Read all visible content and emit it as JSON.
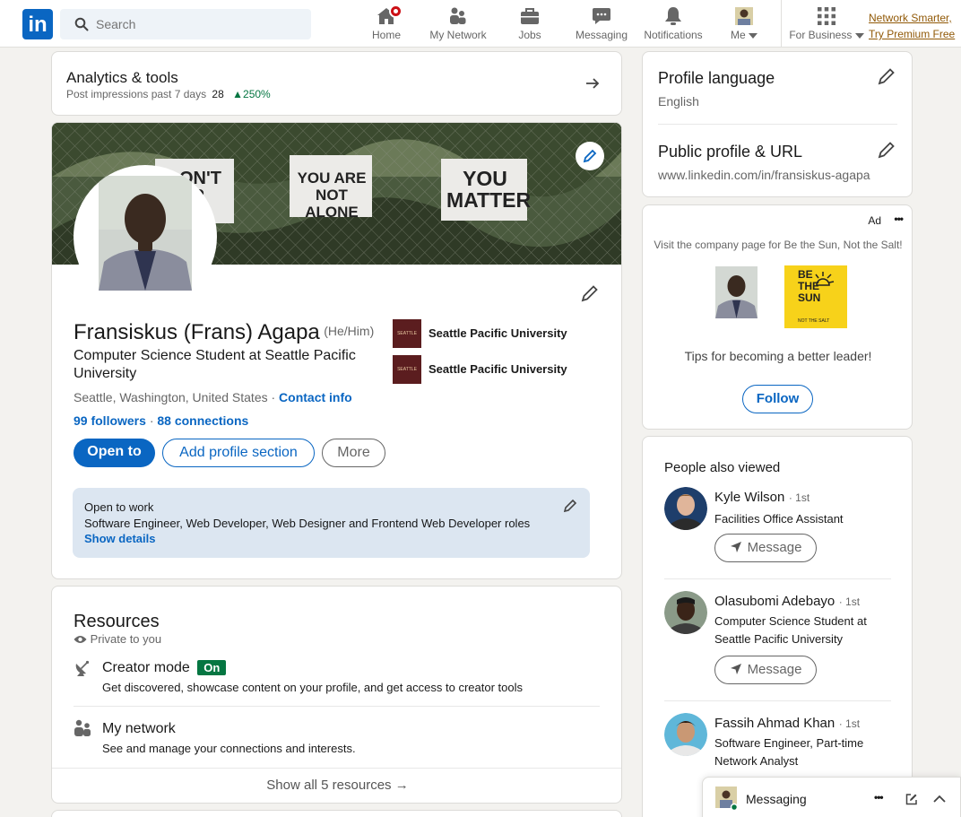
{
  "nav": {
    "logo": "in",
    "search_placeholder": "Search",
    "items": [
      {
        "label": "Home"
      },
      {
        "label": "My Network"
      },
      {
        "label": "Jobs"
      },
      {
        "label": "Messaging"
      },
      {
        "label": "Notifications"
      },
      {
        "label": "Me"
      },
      {
        "label": "For Business"
      }
    ],
    "premium_line1": "Network Smarter,",
    "premium_line2": "Try Premium Free"
  },
  "analytics": {
    "title": "Analytics & tools",
    "subtitle": "Post impressions past 7 days",
    "count": "28",
    "change": "250%"
  },
  "profile": {
    "banner_signs": [
      "ON'T UP",
      "YOU ARE NOT ALONE",
      "YOU MATTER"
    ],
    "name": "Fransiskus (Frans) Agapa",
    "pronouns": "(He/Him)",
    "headline_line1": "Computer Science Student at Seattle Pacific",
    "headline_line2": "University",
    "location": "Seattle, Washington, United States ·",
    "contact_info": "Contact info",
    "followers": "99 followers",
    "dot": "·",
    "connections": "88 connections",
    "schools": [
      {
        "name": "Seattle Pacific University",
        "logo_text": "SEATTLE PACIFIC"
      },
      {
        "name": "Seattle Pacific University",
        "logo_text": "SEATTLE PACIFIC"
      }
    ],
    "btn_open_to": "Open to",
    "btn_add_section": "Add profile section",
    "btn_more": "More",
    "open_to_work_title": "Open to work",
    "open_to_work_roles": "Software Engineer, Web Developer, Web Designer and Frontend Web Developer roles",
    "show_details": "Show details"
  },
  "resources": {
    "title": "Resources",
    "private": "Private to you",
    "creator_title": "Creator mode",
    "creator_badge": "On",
    "creator_desc": "Get discovered, showcase content on your profile, and get access to creator tools",
    "network_title": "My network",
    "network_desc": "See and manage your connections and interests.",
    "show_all": "Show all 5 resources →"
  },
  "sidebar": {
    "lang_title": "Profile language",
    "lang_value": "English",
    "url_title": "Public profile & URL",
    "url_value": "www.linkedin.com/in/fransiskus-agapa"
  },
  "ad": {
    "label": "Ad",
    "more": "•••",
    "text": "Visit the company page for Be the Sun, Not the Salt!",
    "logo_text": "BE THE SUN",
    "logo_sub": "NOT THE SALT",
    "tagline": "Tips for becoming a better leader!",
    "follow": "Follow",
    "accent": "#f7d21a"
  },
  "people": {
    "title": "People also viewed",
    "message_label": "Message",
    "list": [
      {
        "name": "Kyle Wilson",
        "degree": "· 1st",
        "line1": "Facilities Office Assistant",
        "line2": ""
      },
      {
        "name": "Olasubomi Adebayo",
        "degree": "· 1st",
        "line1": "Computer Science Student at",
        "line2": "Seattle Pacific University"
      },
      {
        "name": "Fassih Ahmad Khan",
        "degree": "· 1st",
        "line1": "Software Engineer, Part-time",
        "line2": "Network Analyst"
      }
    ]
  },
  "messaging": {
    "label": "Messaging",
    "more": "•••"
  },
  "colors": {
    "brand": "#0a66c2",
    "success": "#057642",
    "banner_bg": "#3d4a35"
  }
}
